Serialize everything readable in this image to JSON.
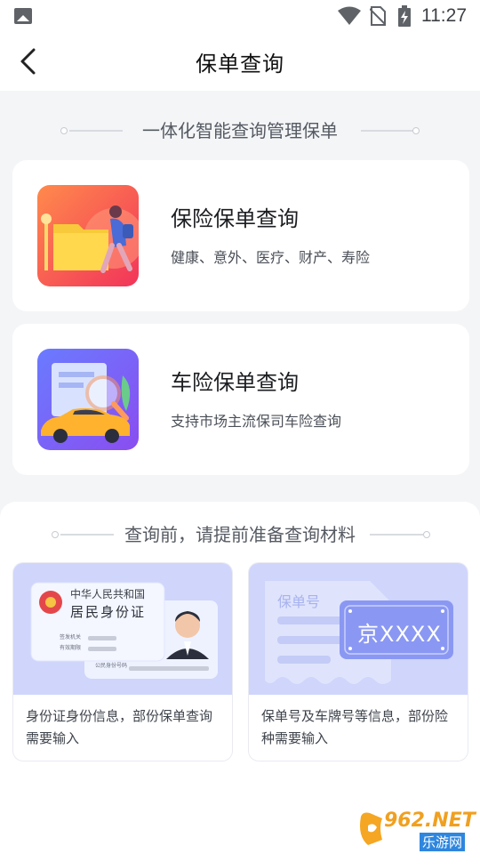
{
  "status_bar": {
    "time": "11:27"
  },
  "header": {
    "title": "保单查询"
  },
  "intro": {
    "caption": "一体化智能查询管理保单"
  },
  "cards": [
    {
      "title": "保险保单查询",
      "subtitle": "健康、意外、医疗、财产、寿险"
    },
    {
      "title": "车险保单查询",
      "subtitle": "支持市场主流保司车险查询"
    }
  ],
  "materials": {
    "caption": "查询前，请提前准备查询材料",
    "items": [
      {
        "id_card_title": "中华人民共和国",
        "id_card_subtitle": "居民身份证",
        "id_card_row1": "签发机关",
        "id_card_row2": "有效期限",
        "id_card_back_note": "公民身份号码",
        "description": "身份证身份信息，部份保单查询需要输入"
      },
      {
        "policy_label": "保单号",
        "plate": "京XXXX",
        "description": "保单号及车牌号等信息，部份险种需要输入"
      }
    ]
  },
  "watermark": {
    "brand": "962.NET",
    "brand_cn": "乐游网"
  },
  "colors": {
    "accent_orange": "#ff6a3d",
    "accent_purple": "#7a5cf5",
    "card_bg": "#cfd5fb",
    "plate_bg": "#8a98f3"
  }
}
